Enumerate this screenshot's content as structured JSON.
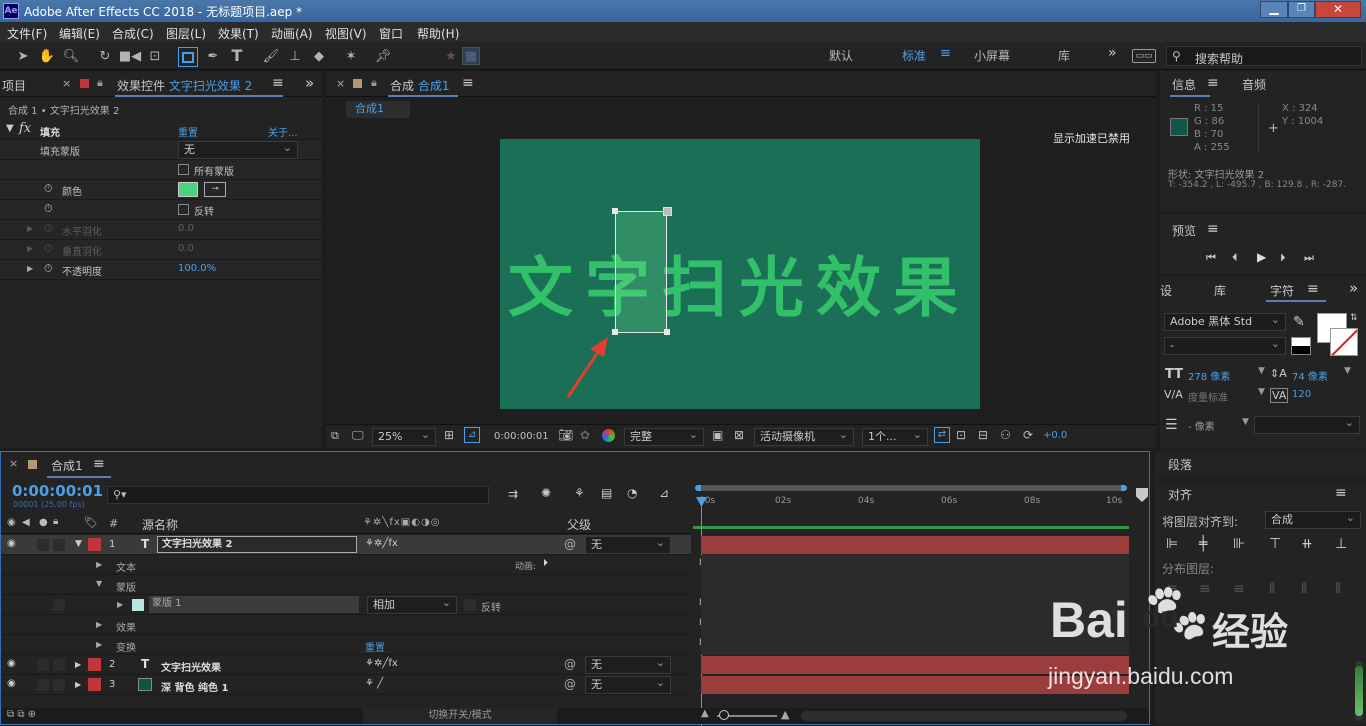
{
  "window": {
    "title": "Adobe After Effects CC 2018 - 无标题项目.aep *",
    "app_icon": "Ae"
  },
  "menu": [
    "文件(F)",
    "编辑(E)",
    "合成(C)",
    "图层(L)",
    "效果(T)",
    "动画(A)",
    "视图(V)",
    "窗口",
    "帮助(H)"
  ],
  "workspaces": {
    "default": "默认",
    "standard": "标准",
    "small_screen": "小屏幕",
    "library": "库",
    "search_placeholder": "搜索帮助"
  },
  "effect_panel": {
    "tab_project": "项目",
    "tab_effect_prefix": "效果控件",
    "tab_effect_layer": "文字扫光效果 2",
    "breadcrumb": "合成 1 • 文字扫光效果 2",
    "fx_name": "填充",
    "reset": "重置",
    "about": "关于...",
    "props": [
      {
        "label": "填充蒙版",
        "value": "无"
      },
      {
        "label": "",
        "value": "所有蒙版"
      },
      {
        "label": "颜色",
        "value": ""
      },
      {
        "label": "",
        "value": "反转"
      },
      {
        "label": "水平羽化",
        "value": "0.0"
      },
      {
        "label": "垂直羽化",
        "value": "0.0"
      },
      {
        "label": "不透明度",
        "value": "100.0%"
      }
    ],
    "fill_color": "#4cd17f"
  },
  "comp_panel": {
    "tab_label": "合成",
    "tab_comp": "合成1",
    "sub_tab": "合成1",
    "notice": "显示加速已禁用",
    "canvas_text": "文字扫光效果",
    "bg_color": "#1a6f56",
    "text_color": "#33c06a",
    "zoom": "25%",
    "timecode": "0:00:00:01",
    "quality": "完整",
    "camera": "活动摄像机",
    "views": "1个...",
    "exposure": "+0.0"
  },
  "info_panel": {
    "tab_info": "信息",
    "tab_audio": "音频",
    "r": "R : 15",
    "g": "G : 86",
    "b": "B : 70",
    "a": "A : 255",
    "x": "X : 324",
    "y": "Y : 1004",
    "shape": "形状: 文字扫光效果 2",
    "coords": "T: -354.2 , L: -495.7 , B: 129.8 , R: -287.",
    "swatch": "#0f5646"
  },
  "preview_panel": {
    "title": "预览"
  },
  "char_panel": {
    "tab_paragraph_settings": "设",
    "tab_library": "库",
    "tab_character": "字符",
    "font": "Adobe 黑体 Std",
    "style": "-",
    "size": "278 像素",
    "leading": "74 像素",
    "kerning": "度量标准",
    "tracking": "120",
    "stroke": "- 像素"
  },
  "paragraph_panel": {
    "title": "段落"
  },
  "align_panel": {
    "title": "对齐",
    "align_to_label": "将图层对齐到:",
    "align_to_value": "合成",
    "distribute_label": "分布图层:"
  },
  "timeline": {
    "tab": "合成1",
    "timecode": "0:00:00:01",
    "frames": "00001 (25.00 fps)",
    "col_source": "源名称",
    "col_parent": "父级",
    "ruler": [
      "00s",
      "02s",
      "04s",
      "06s",
      "08s",
      "10s"
    ],
    "rows": [
      {
        "num": "1",
        "name": "文字扫光效果 2",
        "parent": "无"
      },
      {
        "label": "文本",
        "extra": "动画:"
      },
      {
        "label": "蒙版"
      },
      {
        "label": "蒙版 1",
        "mode": "相加",
        "invert": "反转"
      },
      {
        "label": "效果"
      },
      {
        "label": "变换",
        "extra": "重置"
      },
      {
        "num": "2",
        "name": "文字扫光效果",
        "parent": "无"
      },
      {
        "num": "3",
        "name": "深 背色 纯色 1",
        "parent": "无"
      }
    ],
    "footer": "切换开关/模式"
  },
  "watermark": {
    "brand": "Bai",
    "brand2": "du",
    "brand3": "经验",
    "url": "jingyan.baidu.com"
  }
}
